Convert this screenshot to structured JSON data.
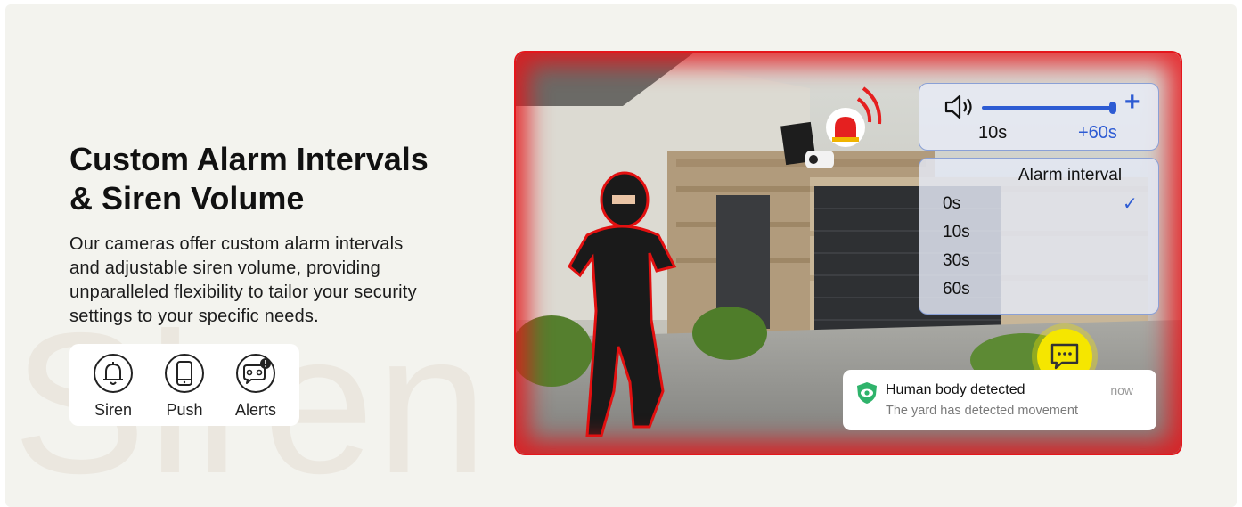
{
  "watermark": "Siren",
  "heading": {
    "line1": "Custom Alarm Intervals",
    "line2": "& Siren Volume"
  },
  "description": {
    "line1": "Our cameras offer custom alarm intervals",
    "line2": "and adjustable siren volume, providing",
    "line3": "unparalleled flexibility to tailor your security",
    "line4": "settings to your specific needs."
  },
  "features": [
    {
      "label": "Siren",
      "icon": "bell-icon"
    },
    {
      "label": "Push",
      "icon": "phone-icon"
    },
    {
      "label": "Alerts",
      "icon": "alert-message-icon"
    }
  ],
  "volume": {
    "min_label": "10s",
    "max_label": "+60s",
    "level": 0.95,
    "icon": "speaker-icon"
  },
  "alarm_interval": {
    "title": "Alarm interval",
    "options": [
      "0s",
      "10s",
      "30s",
      "60s"
    ],
    "selected": "0s"
  },
  "notification": {
    "title": "Human body detected",
    "body": "The yard has detected movement",
    "time": "now",
    "icon": "shield-eye-icon"
  },
  "colors": {
    "accent_blue": "#2d5bd3",
    "alarm_red": "#e5161c",
    "chat_yellow": "#f5e600"
  }
}
